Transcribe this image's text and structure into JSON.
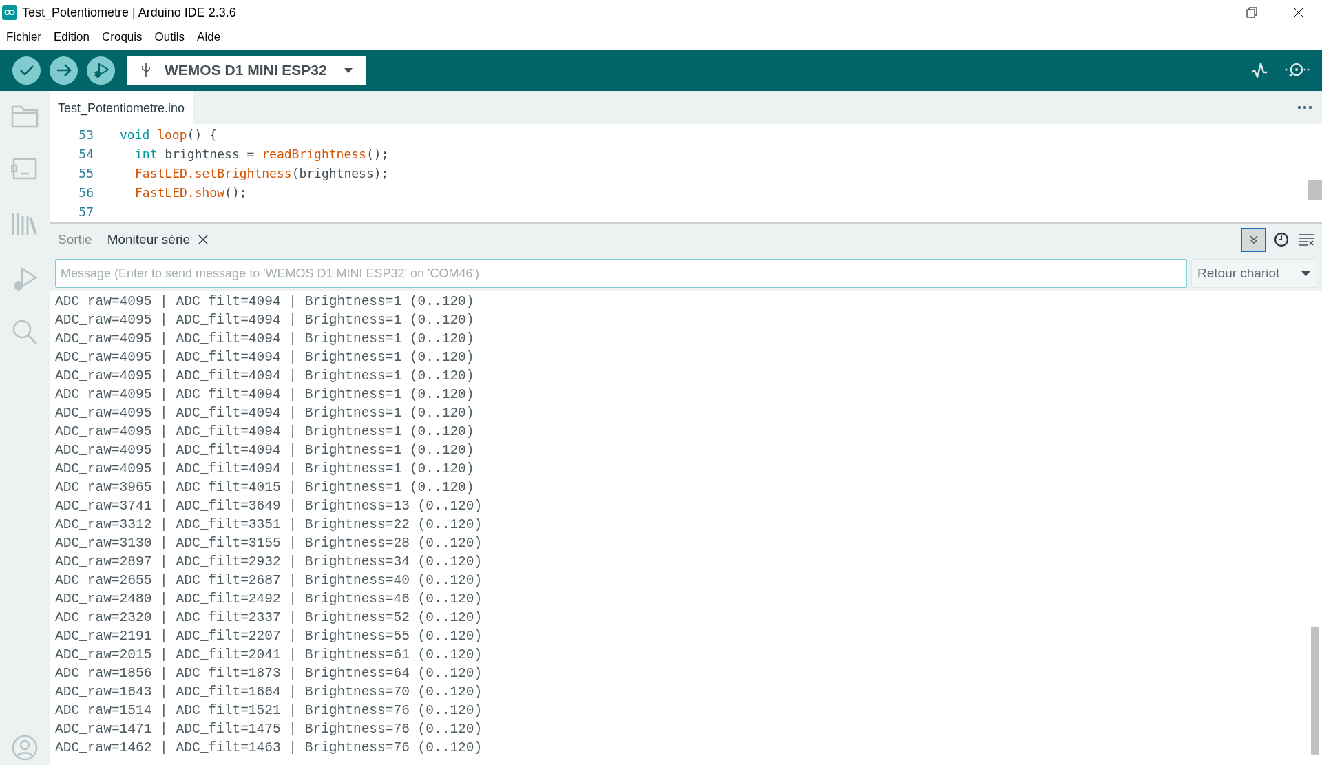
{
  "window": {
    "title": "Test_Potentiometre | Arduino IDE 2.3.6"
  },
  "menu": [
    "Fichier",
    "Edition",
    "Croquis",
    "Outils",
    "Aide"
  ],
  "board": {
    "name": "WEMOS D1 MINI ESP32"
  },
  "editor_tabs": [
    {
      "label": "Test_Potentiometre.ino",
      "selected": true
    }
  ],
  "code": [
    {
      "number": "53",
      "tokens": [
        {
          "kind": "keyword",
          "text": "void "
        },
        {
          "kind": "function",
          "text": "loop"
        },
        {
          "kind": "plain",
          "text": "() {"
        }
      ],
      "children": [
        {
          "number": "54",
          "tokens": [
            {
              "kind": "keyword",
              "text": "int"
            },
            {
              "kind": "plain",
              "text": " brightness = "
            },
            {
              "kind": "function",
              "text": "readBrightness"
            },
            {
              "kind": "plain",
              "text": "();"
            }
          ]
        },
        {
          "number": "55",
          "tokens": [
            {
              "kind": "function",
              "text": "FastLED.setBrightness"
            },
            {
              "kind": "plain",
              "text": "(brightness);"
            }
          ]
        },
        {
          "number": "56",
          "tokens": [
            {
              "kind": "function",
              "text": "FastLED.show"
            },
            {
              "kind": "plain",
              "text": "();"
            }
          ]
        },
        {
          "number": "57"
        }
      ]
    }
  ],
  "panel_tabs": [
    {
      "label": "Sortie",
      "selected": false,
      "closable": false
    },
    {
      "label": "Moniteur série",
      "selected": true,
      "closable": true
    }
  ],
  "autoscroll": {
    "on": true
  },
  "message_field": {
    "placeholder": "Message (Enter to send message to 'WEMOS D1 MINI ESP32' on 'COM46')"
  },
  "line_ending": {
    "value": "Retour chariot"
  },
  "serial_output": [
    "ADC_raw=4095 | ADC_filt=4094 | Brightness=1 (0..120)",
    "ADC_raw=4095 | ADC_filt=4094 | Brightness=1 (0..120)",
    "ADC_raw=4095 | ADC_filt=4094 | Brightness=1 (0..120)",
    "ADC_raw=4095 | ADC_filt=4094 | Brightness=1 (0..120)",
    "ADC_raw=4095 | ADC_filt=4094 | Brightness=1 (0..120)",
    "ADC_raw=4095 | ADC_filt=4094 | Brightness=1 (0..120)",
    "ADC_raw=4095 | ADC_filt=4094 | Brightness=1 (0..120)",
    "ADC_raw=4095 | ADC_filt=4094 | Brightness=1 (0..120)",
    "ADC_raw=4095 | ADC_filt=4094 | Brightness=1 (0..120)",
    "ADC_raw=4095 | ADC_filt=4094 | Brightness=1 (0..120)",
    "ADC_raw=3965 | ADC_filt=4015 | Brightness=1 (0..120)",
    "ADC_raw=3741 | ADC_filt=3649 | Brightness=13 (0..120)",
    "ADC_raw=3312 | ADC_filt=3351 | Brightness=22 (0..120)",
    "ADC_raw=3130 | ADC_filt=3155 | Brightness=28 (0..120)",
    "ADC_raw=2897 | ADC_filt=2932 | Brightness=34 (0..120)",
    "ADC_raw=2655 | ADC_filt=2687 | Brightness=40 (0..120)",
    "ADC_raw=2480 | ADC_filt=2492 | Brightness=46 (0..120)",
    "ADC_raw=2320 | ADC_filt=2337 | Brightness=52 (0..120)",
    "ADC_raw=2191 | ADC_filt=2207 | Brightness=55 (0..120)",
    "ADC_raw=2015 | ADC_filt=2041 | Brightness=61 (0..120)",
    "ADC_raw=1856 | ADC_filt=1873 | Brightness=64 (0..120)",
    "ADC_raw=1643 | ADC_filt=1664 | Brightness=70 (0..120)",
    "ADC_raw=1514 | ADC_filt=1521 | Brightness=76 (0..120)",
    "ADC_raw=1471 | ADC_filt=1475 | Brightness=76 (0..120)",
    "ADC_raw=1462 | ADC_filt=1463 | Brightness=76 (0..120)"
  ]
}
